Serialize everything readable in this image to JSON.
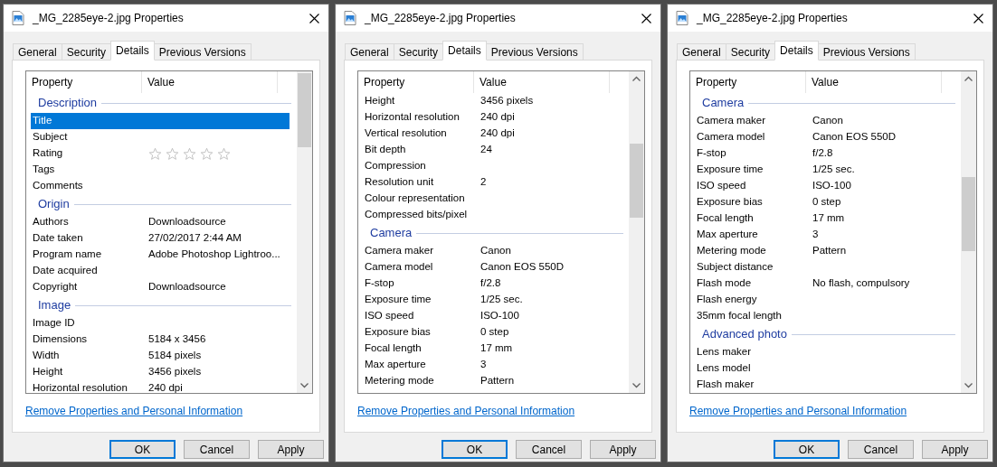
{
  "dialogs": [
    {
      "title": "_MG_2285eye-2.jpg Properties",
      "tabs": [
        {
          "label": "General",
          "selected": false
        },
        {
          "label": "Security",
          "selected": false
        },
        {
          "label": "Details",
          "selected": true
        },
        {
          "label": "Previous Versions",
          "selected": false
        }
      ],
      "columns": [
        "Property",
        "Value"
      ],
      "sections": [
        {
          "heading": "Description",
          "rows": [
            {
              "property": "Title",
              "selected": true
            },
            {
              "property": "Subject",
              "selected": false
            },
            {
              "property": "Rating",
              "stars": 0,
              "selected": false
            },
            {
              "property": "Tags",
              "selected": false
            },
            {
              "property": "Comments",
              "selected": false
            }
          ]
        },
        {
          "heading": "Origin",
          "rows": [
            {
              "property": "Authors",
              "value": "Downloadsource",
              "selected": false
            },
            {
              "property": "Date taken",
              "value": "27/02/2017 2:44 AM",
              "selected": false
            },
            {
              "property": "Program name",
              "value": "Adobe Photoshop Lightroo...",
              "selected": false
            },
            {
              "property": "Date acquired",
              "selected": false
            },
            {
              "property": "Copyright",
              "value": "Downloadsource",
              "selected": false
            }
          ]
        },
        {
          "heading": "Image",
          "rows": [
            {
              "property": "Image ID",
              "selected": false
            },
            {
              "property": "Dimensions",
              "value": "5184 x 3456",
              "selected": false
            },
            {
              "property": "Width",
              "value": "5184 pixels",
              "selected": false
            },
            {
              "property": "Height",
              "value": "3456 pixels",
              "selected": false
            },
            {
              "property": "Horizontal resolution",
              "value": "240 dpi",
              "selected": false
            }
          ]
        }
      ],
      "link": "Remove Properties and Personal Information",
      "buttons": [
        {
          "label": "OK",
          "default": true
        },
        {
          "label": "Cancel",
          "default": false
        },
        {
          "label": "Apply",
          "default": false
        }
      ]
    },
    {
      "title": "_MG_2285eye-2.jpg Properties",
      "tabs": [
        {
          "label": "General",
          "selected": false
        },
        {
          "label": "Security",
          "selected": false
        },
        {
          "label": "Details",
          "selected": true
        },
        {
          "label": "Previous Versions",
          "selected": false
        }
      ],
      "columns": [
        "Property",
        "Value"
      ],
      "sections": [
        {
          "rows": [
            {
              "property": "Height",
              "value": "3456 pixels",
              "selected": false
            },
            {
              "property": "Horizontal resolution",
              "value": "240 dpi",
              "selected": false
            },
            {
              "property": "Vertical resolution",
              "value": "240 dpi",
              "selected": false
            },
            {
              "property": "Bit depth",
              "value": "24",
              "selected": false
            },
            {
              "property": "Compression",
              "selected": false
            },
            {
              "property": "Resolution unit",
              "value": "2",
              "selected": false
            },
            {
              "property": "Colour representation",
              "selected": false
            },
            {
              "property": "Compressed bits/pixel",
              "selected": false
            }
          ]
        },
        {
          "heading": "Camera",
          "rows": [
            {
              "property": "Camera maker",
              "value": "Canon",
              "selected": false
            },
            {
              "property": "Camera model",
              "value": "Canon EOS 550D",
              "selected": false
            },
            {
              "property": "F-stop",
              "value": "f/2.8",
              "selected": false
            },
            {
              "property": "Exposure time",
              "value": "1/25 sec.",
              "selected": false
            },
            {
              "property": "ISO speed",
              "value": "ISO-100",
              "selected": false
            },
            {
              "property": "Exposure bias",
              "value": "0 step",
              "selected": false
            },
            {
              "property": "Focal length",
              "value": "17 mm",
              "selected": false
            },
            {
              "property": "Max aperture",
              "value": "3",
              "selected": false
            },
            {
              "property": "Metering mode",
              "value": "Pattern",
              "selected": false
            }
          ]
        }
      ],
      "link": "Remove Properties and Personal Information",
      "buttons": [
        {
          "label": "OK",
          "default": true
        },
        {
          "label": "Cancel",
          "default": false
        },
        {
          "label": "Apply",
          "default": false
        }
      ]
    },
    {
      "title": "_MG_2285eye-2.jpg Properties",
      "tabs": [
        {
          "label": "General",
          "selected": false
        },
        {
          "label": "Security",
          "selected": false
        },
        {
          "label": "Details",
          "selected": true
        },
        {
          "label": "Previous Versions",
          "selected": false
        }
      ],
      "columns": [
        "Property",
        "Value"
      ],
      "sections": [
        {
          "heading": "Camera",
          "rows": [
            {
              "property": "Camera maker",
              "value": "Canon",
              "selected": false
            },
            {
              "property": "Camera model",
              "value": "Canon EOS 550D",
              "selected": false
            },
            {
              "property": "F-stop",
              "value": "f/2.8",
              "selected": false
            },
            {
              "property": "Exposure time",
              "value": "1/25 sec.",
              "selected": false
            },
            {
              "property": "ISO speed",
              "value": "ISO-100",
              "selected": false
            },
            {
              "property": "Exposure bias",
              "value": "0 step",
              "selected": false
            },
            {
              "property": "Focal length",
              "value": "17 mm",
              "selected": false
            },
            {
              "property": "Max aperture",
              "value": "3",
              "selected": false
            },
            {
              "property": "Metering mode",
              "value": "Pattern",
              "selected": false
            },
            {
              "property": "Subject distance",
              "selected": false
            },
            {
              "property": "Flash mode",
              "value": "No flash, compulsory",
              "selected": false
            },
            {
              "property": "Flash energy",
              "selected": false
            },
            {
              "property": "35mm focal length",
              "selected": false
            }
          ]
        },
        {
          "heading": "Advanced photo",
          "rows": [
            {
              "property": "Lens maker",
              "selected": false
            },
            {
              "property": "Lens model",
              "selected": false
            },
            {
              "property": "Flash maker",
              "selected": false
            }
          ]
        }
      ],
      "link": "Remove Properties and Personal Information",
      "buttons": [
        {
          "label": "OK",
          "default": true
        },
        {
          "label": "Cancel",
          "default": false
        },
        {
          "label": "Apply",
          "default": false
        }
      ]
    }
  ]
}
